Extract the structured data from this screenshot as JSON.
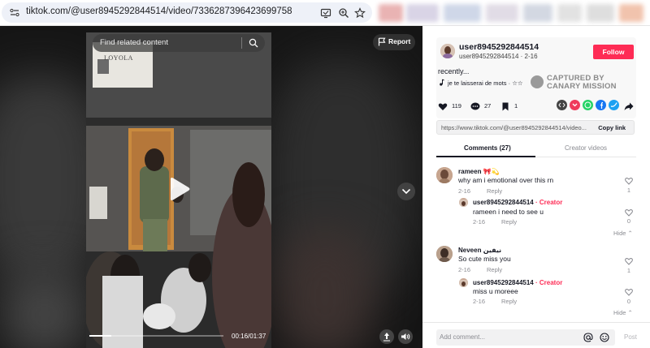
{
  "browser": {
    "url": "tiktok.com/@user8945292844514/video/7336287396423699758",
    "icons": [
      "site-settings-icon",
      "cast-icon",
      "zoom-icon",
      "bookmark-star-icon"
    ]
  },
  "player": {
    "search_placeholder": "Find related content",
    "report_label": "Report",
    "current_time": "00:16",
    "duration": "01:37",
    "time_display": "00:16/01:37",
    "progress_fraction": 0.165
  },
  "creator": {
    "username": "user8945292844514",
    "handle_line": "user8945292844514 · 2-16",
    "follow_label": "Follow",
    "description": "recently...",
    "music": "je te laisserai de mots · ☆☆"
  },
  "watermark": {
    "line1": "CAPTURED BY",
    "line2": "CANARY MISSION"
  },
  "stats": {
    "likes": "119",
    "comments": "27",
    "saves": "1"
  },
  "share": {
    "link": "https://www.tiktok.com/@user8945292844514/video...",
    "copy_label": "Copy link",
    "colors": {
      "embed": "#444444",
      "pocket": "#ef3b5c",
      "whatsapp": "#25d366",
      "facebook": "#1877f2",
      "twitter": "#1da1f2"
    }
  },
  "tabs": {
    "comments_label": "Comments (27)",
    "creator_videos_label": "Creator videos"
  },
  "comments": [
    {
      "name": "rameen 🎀💫",
      "text": "why am i emotional over this rn",
      "date": "2-16",
      "reply_label": "Reply",
      "likes": "1",
      "replies": [
        {
          "name": "user8945292844514",
          "creator_tag": " · Creator",
          "text": "rameen i need to see u",
          "date": "2-16",
          "reply_label": "Reply",
          "likes": "0"
        }
      ],
      "hide_label": "Hide"
    },
    {
      "name": "Neveen نيفين",
      "text": "So cute miss you",
      "date": "2-16",
      "reply_label": "Reply",
      "likes": "1",
      "replies": [
        {
          "name": "user8945292844514",
          "creator_tag": " · Creator",
          "text": "miss u moreee",
          "date": "2-16",
          "reply_label": "Reply",
          "likes": "0"
        }
      ],
      "hide_label": "Hide"
    }
  ],
  "composer": {
    "placeholder": "Add comment...",
    "post_label": "Post"
  },
  "sign": {
    "line1": "LOYOLA"
  }
}
